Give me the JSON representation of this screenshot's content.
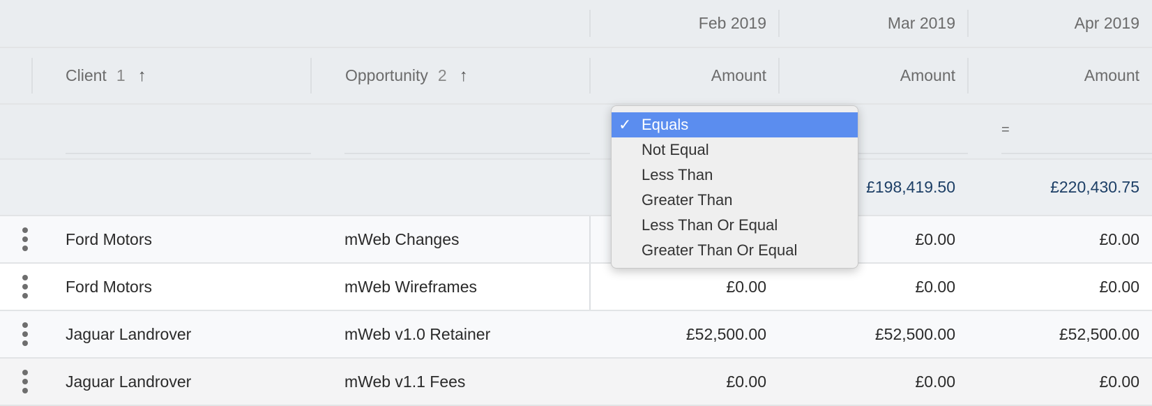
{
  "header_months": [
    "Feb 2019",
    "Mar 2019",
    "Apr 2019"
  ],
  "columns": {
    "client": {
      "label": "Client",
      "sort_order": "1",
      "sort_direction": "ascending"
    },
    "opportunity": {
      "label": "Opportunity",
      "sort_order": "2",
      "sort_direction": "ascending"
    },
    "amount_label": "Amount"
  },
  "filter": {
    "apr_operator": "="
  },
  "totals": [
    "",
    "£198,419.50",
    "£220,430.75"
  ],
  "rows": [
    {
      "client": "Ford Motors",
      "opportunity": "mWeb Changes",
      "amounts": [
        "",
        "£0.00",
        "£0.00"
      ]
    },
    {
      "client": "Ford Motors",
      "opportunity": "mWeb Wireframes",
      "amounts": [
        "£0.00",
        "£0.00",
        "£0.00"
      ]
    },
    {
      "client": "Jaguar Landrover",
      "opportunity": "mWeb v1.0 Retainer",
      "amounts": [
        "£52,500.00",
        "£52,500.00",
        "£52,500.00"
      ]
    },
    {
      "client": "Jaguar Landrover",
      "opportunity": "mWeb v1.1 Fees",
      "amounts": [
        "£0.00",
        "£0.00",
        "£0.00"
      ]
    }
  ],
  "dropdown": {
    "selected": "Equals",
    "options": [
      "Equals",
      "Not Equal",
      "Less Than",
      "Greater Than",
      "Less Than Or Equal",
      "Greater Than Or Equal"
    ]
  },
  "colors": {
    "accent": "#5b8def",
    "total_text": "#1d3f66",
    "header_bg": "#eaedf0"
  }
}
